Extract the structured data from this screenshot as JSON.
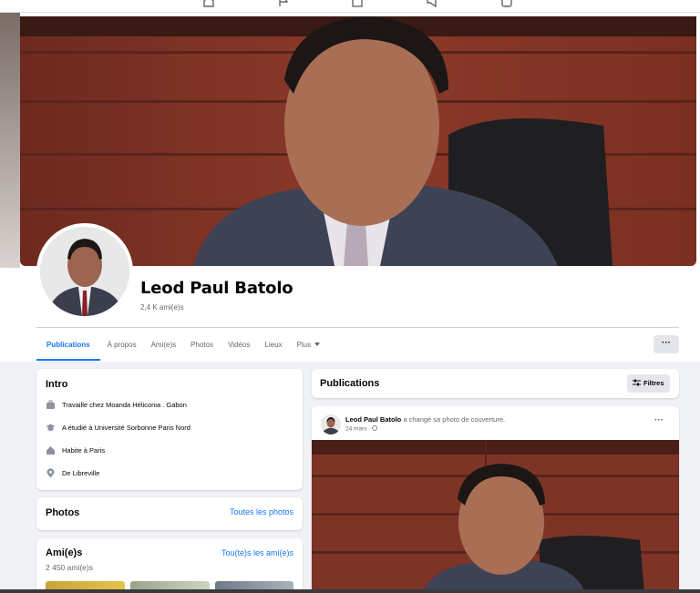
{
  "topnav": {
    "icons": [
      "home-icon",
      "flag-icon",
      "marketplace-icon",
      "megaphone-icon",
      "gaming-icon"
    ]
  },
  "profile": {
    "name": "Leod Paul Batolo",
    "friends_count": "2,4 K ami(e)s"
  },
  "tabs": [
    {
      "label": "Publications",
      "active": true
    },
    {
      "label": "À propos"
    },
    {
      "label": "Ami(e)s"
    },
    {
      "label": "Photos"
    },
    {
      "label": "Vidéos"
    },
    {
      "label": "Lieux"
    },
    {
      "label": "Plus"
    }
  ],
  "more_button": "···",
  "intro": {
    "title": "Intro",
    "items": [
      {
        "icon": "briefcase-icon",
        "text": "Travaille chez Moanda Héliconia . Gabon"
      },
      {
        "icon": "graduation-cap-icon",
        "text": "A étudié à Université Sorbonne Paris Nord"
      },
      {
        "icon": "home-icon",
        "text": "Habite à Paris"
      },
      {
        "icon": "location-pin-icon",
        "text": "De Libreville"
      }
    ]
  },
  "photos": {
    "title": "Photos",
    "link": "Toutes les photos"
  },
  "friends": {
    "title": "Ami(e)s",
    "link": "Tou(te)s les ami(e)s",
    "count": "2 450 ami(e)s"
  },
  "publications": {
    "title": "Publications",
    "filters_label": "Filtres"
  },
  "post": {
    "author": "Leod Paul Batolo",
    "action": " a changé sa photo de couverture.",
    "date": "24 mars · ",
    "menu": "···"
  },
  "colors": {
    "accent": "#1877f2",
    "background": "#f0f2f5",
    "secondary_text": "#65676b"
  }
}
